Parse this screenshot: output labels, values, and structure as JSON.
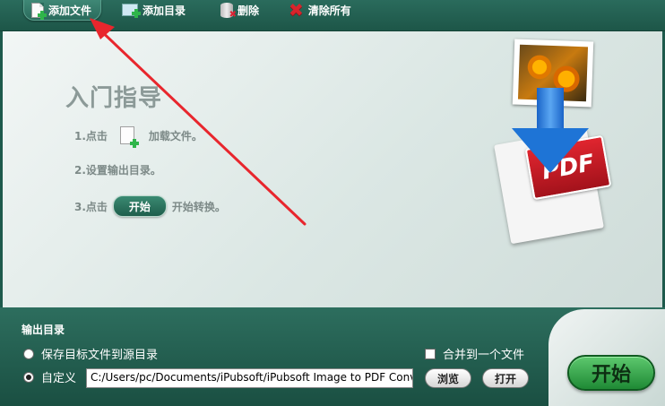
{
  "toolbar": {
    "add_file": "添加文件",
    "add_dir": "添加目录",
    "delete": "删除",
    "clear_all": "清除所有"
  },
  "guide": {
    "title": "入门指导",
    "step1_prefix": "1.点击",
    "step1_suffix": "加载文件。",
    "step2": "2.设置输出目录。",
    "step3_prefix": "3.点击",
    "step3_button": "开始",
    "step3_suffix": "开始转换。"
  },
  "illustration": {
    "pdf_label": "PDF"
  },
  "output": {
    "section_label": "输出目录",
    "option_source": "保存目标文件到源目录",
    "option_custom": "自定义",
    "selected": "custom",
    "path_value": "C:/Users/pc/Documents/iPubsoft/iPubsoft Image to PDF Conv",
    "browse_label": "浏览",
    "open_label": "打开",
    "merge_label": "合并到一个文件",
    "merge_checked": false
  },
  "start_label": "开始",
  "colors": {
    "toolbar": "#1d5648",
    "annotation": "#e8262d",
    "start": "#2fa845"
  }
}
